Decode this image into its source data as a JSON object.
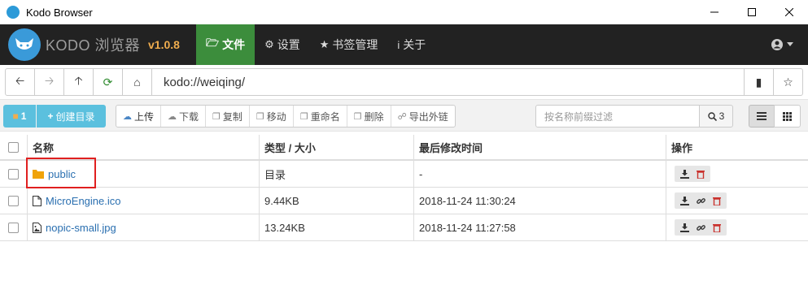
{
  "window": {
    "title": "Kodo Browser"
  },
  "navbar": {
    "brand": "KODO 浏览器",
    "version": "v1.0.8",
    "items": [
      {
        "label": "文件",
        "icon": "folder-icon",
        "active": true
      },
      {
        "label": "设置",
        "icon": "gear-icon",
        "active": false
      },
      {
        "label": "书签管理",
        "icon": "star-icon",
        "active": false
      },
      {
        "label": "关于",
        "icon": "info-icon",
        "active": false
      }
    ]
  },
  "address": {
    "value": "kodo://weiqing/"
  },
  "toolbar": {
    "count": "1",
    "new_dir": "创建目录",
    "actions": [
      "上传",
      "下载",
      "复制",
      "移动",
      "重命名",
      "删除",
      "导出外链"
    ],
    "filter_placeholder": "按名称前缀过滤",
    "filter_count": "3"
  },
  "table": {
    "headers": {
      "name": "名称",
      "type": "类型 / 大小",
      "time": "最后修改时间",
      "ops": "操作"
    },
    "rows": [
      {
        "name": "public",
        "type": "目录",
        "time": "-",
        "kind": "folder"
      },
      {
        "name": "MicroEngine.ico",
        "type": "9.44KB",
        "time": "2018-11-24 11:30:24",
        "kind": "file"
      },
      {
        "name": "nopic-small.jpg",
        "type": "13.24KB",
        "time": "2018-11-24 11:27:58",
        "kind": "image"
      }
    ]
  },
  "colors": {
    "navbar": "#222222",
    "active_tab": "#3c8d3c",
    "version": "#f0ad4e",
    "info_button": "#5bc0de",
    "link": "#2a6fb0",
    "highlight": "#e02020"
  }
}
